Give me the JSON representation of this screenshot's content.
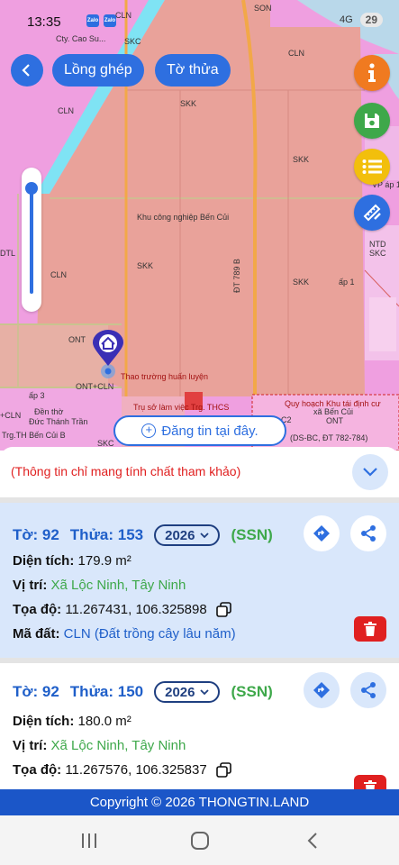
{
  "status": {
    "time": "13:35",
    "zalo": "Zalo",
    "signal": "4G",
    "battery": "29"
  },
  "map": {
    "labels": {
      "cln_top": "CLN",
      "son": "SON",
      "cty": "Cty. Cao Su...",
      "skc_top": "SKC",
      "cln_a": "CLN",
      "cln_b": "CLN",
      "cln_c": "CLN",
      "skk_1": "SKK",
      "skk_2": "SKK",
      "skk_3": "SKK",
      "skk_4": "SKK",
      "kcn": "Khu công nghiệp Bến Củi",
      "road": "ĐT 789 B",
      "dtl": "DTL",
      "ont": "ONT",
      "ont_cln": "ONT+CLN",
      "ap3": "ấp 3",
      "ap1": "ấp 1",
      "cln_left": "+CLN",
      "den_tho": "Đền thờ",
      "duc_thanh": "Đức Thánh Trần",
      "truong": "Trg.TH Bến Củi B",
      "skc_bot": "SKC",
      "thao_truong": "Thao trường huấn luyện",
      "tru_so": "Trụ sở làm việc Trg. THCS",
      "quy_hoach": "Quy hoạch Khu tái định cư",
      "xa_ben_cui": "xã Bến Củi",
      "ont_r": "ONT",
      "ds_bc": "(DS-BC, ĐT 782-784)",
      "vp": "VP áp 1",
      "ntd": "NTD",
      "skc_r": "SKC",
      "c2": "C2"
    }
  },
  "toolbar": {
    "long_ghep": "Lồng ghép",
    "to_thua": "Tờ thửa"
  },
  "post": {
    "label": "Đăng tin tại đây."
  },
  "sheet": {
    "notice": "(Thông tin chỉ mang tính chất tham khảo)"
  },
  "parcels": [
    {
      "to_label": "Tờ:",
      "to": "92",
      "thua_label": "Thửa:",
      "thua": "153",
      "year": "2026",
      "source": "(SSN)",
      "area_label": "Diện tích:",
      "area": "179.9 m²",
      "loc_label": "Vị trí:",
      "location": "Xã Lộc Ninh, Tây Ninh",
      "coord_label": "Tọa độ:",
      "coords": "11.267431, 106.325898",
      "code_label": "Mã đất:",
      "code": "CLN (Đất trồng cây lâu năm)"
    },
    {
      "to_label": "Tờ:",
      "to": "92",
      "thua_label": "Thửa:",
      "thua": "150",
      "year": "2026",
      "source": "(SSN)",
      "area_label": "Diện tích:",
      "area": "180.0 m²",
      "loc_label": "Vị trí:",
      "location": "Xã Lộc Ninh, Tây Ninh",
      "coord_label": "Tọa độ:",
      "coords": "11.267576, 106.325837"
    }
  ],
  "footer": {
    "copyright": "Copyright © 2026 THONGTIN.LAND"
  },
  "colors": {
    "primary": "#2e6fe0",
    "accent_green": "#3ea84a",
    "danger": "#e02020",
    "map_zone": "#ef9fe0",
    "industrial": "#e9a29a"
  }
}
